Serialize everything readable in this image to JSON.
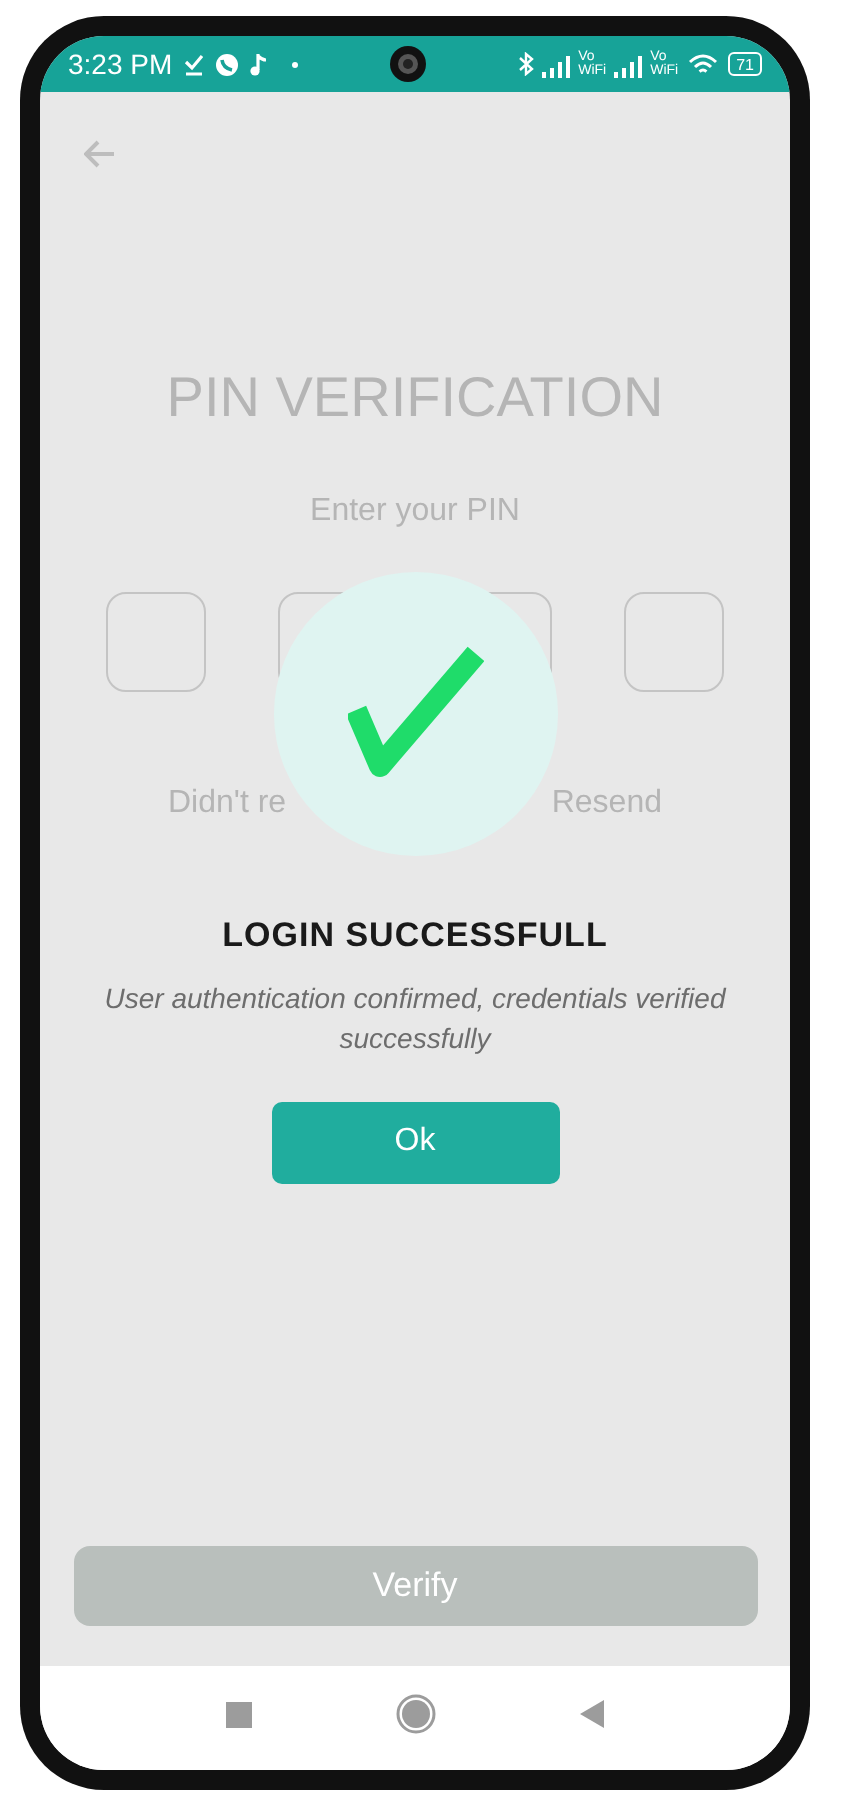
{
  "status_bar": {
    "time": "3:23 PM",
    "network_labels": [
      {
        "top": "Vo",
        "bottom": "WiFi"
      },
      {
        "top": "Vo",
        "bottom": "WiFi"
      }
    ],
    "battery": "71"
  },
  "background_screen": {
    "title": "PIN VERIFICATION",
    "prompt": "Enter your PIN",
    "resend_hidden_start": "Didn't re",
    "resend_link": "Resend",
    "button": "Verify"
  },
  "dialog": {
    "title": "LOGIN SUCCESSFULL",
    "message": "User authentication confirmed, credentials verified successfully",
    "button": "Ok"
  }
}
